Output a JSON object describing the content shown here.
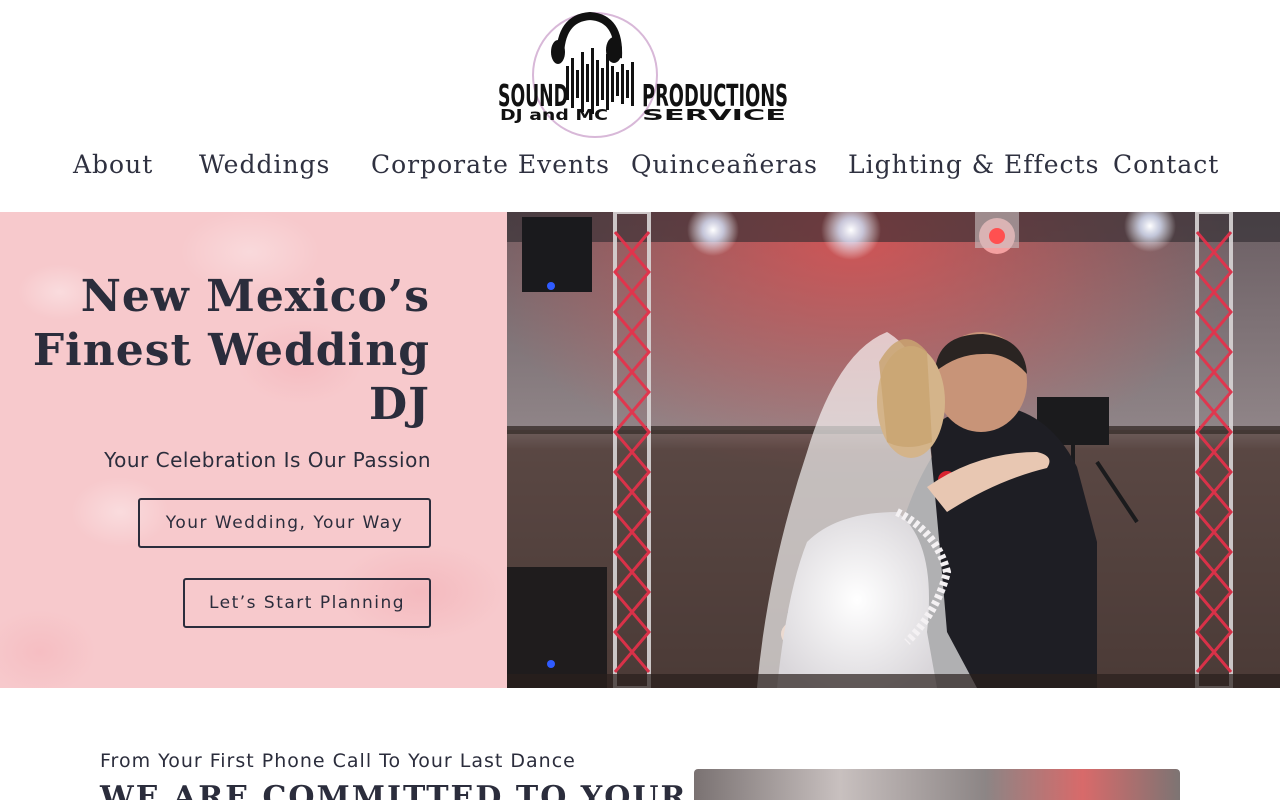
{
  "header": {
    "logo": {
      "brand_line1": "SOUND",
      "brand_line1b": "PRODUCTIONS",
      "brand_line2": "DJ and MC",
      "brand_line2b": "SERVICE"
    },
    "nav": [
      {
        "label": "About"
      },
      {
        "label": "Weddings"
      },
      {
        "label": "Corporate Events"
      },
      {
        "label": "Quinceañeras"
      },
      {
        "label": "Lighting & Effects"
      },
      {
        "label": "Contact"
      }
    ]
  },
  "hero": {
    "title_line1": "New Mexico’s",
    "title_line2": "Finest Wedding",
    "title_line3": "DJ",
    "subtitle": "Your Celebration Is Our Passion",
    "button_primary": "Your Wedding, Your Way",
    "button_secondary": "Let’s Start Planning",
    "background_color": "#f7c9cc"
  },
  "intro": {
    "tagline": "From Your First Phone Call To Your Last Dance",
    "heading": "WE ARE COMMITTED TO YOUR"
  },
  "colors": {
    "text_dark": "#2b2d3c",
    "accent_pink": "#f7c9cc",
    "truss_red": "#e8304a"
  }
}
